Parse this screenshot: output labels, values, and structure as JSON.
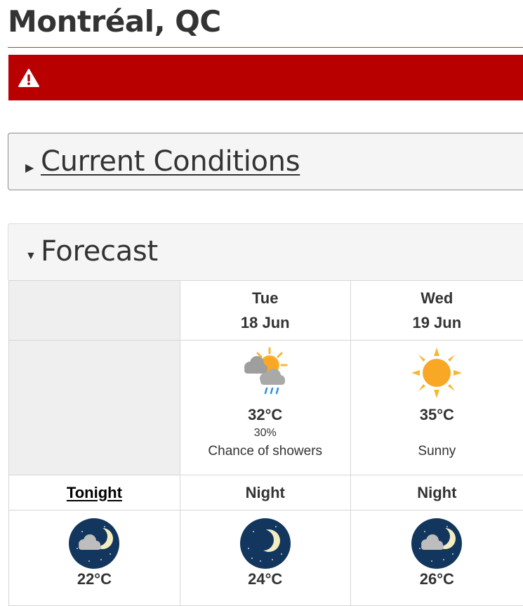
{
  "location": {
    "title": "Montréal, QC"
  },
  "alert": {
    "icon": "warning-triangle-icon",
    "color": "#b90000"
  },
  "sections": {
    "current_conditions": {
      "label": "Current Conditions",
      "expanded": false
    },
    "forecast": {
      "label": "Forecast",
      "expanded": true
    }
  },
  "forecast": {
    "days": [
      {
        "weekday": "Tue",
        "date": "18 Jun",
        "icon": "sun-cloud-showers-icon",
        "temp": "32°C",
        "pop": "30%",
        "summary": "Chance of showers"
      },
      {
        "weekday": "Wed",
        "date": "19 Jun",
        "icon": "sun-icon",
        "temp": "35°C",
        "pop": "",
        "summary": "Sunny"
      }
    ],
    "nights": [
      {
        "label": "Tonight",
        "icon": "night-moon-cloud-icon",
        "temp": "22°C",
        "link": true
      },
      {
        "label": "Night",
        "icon": "night-moon-icon",
        "temp": "24°C",
        "link": false
      },
      {
        "label": "Night",
        "icon": "night-moon-cloud-icon",
        "temp": "26°C",
        "link": false
      }
    ]
  }
}
